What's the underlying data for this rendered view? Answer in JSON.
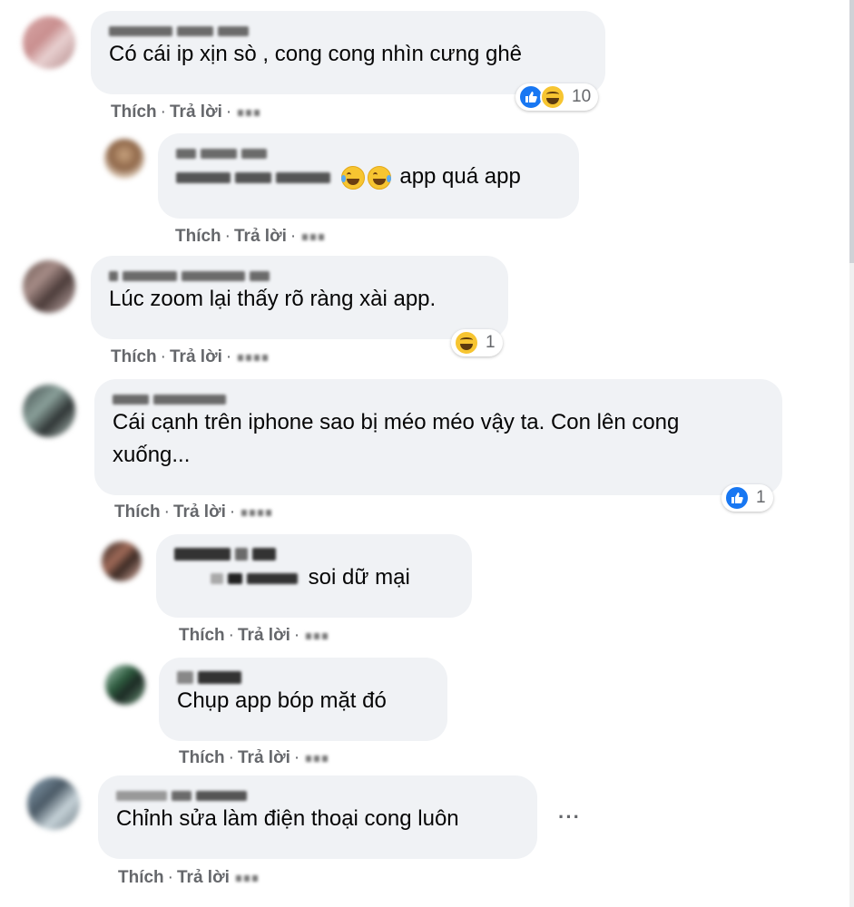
{
  "actions": {
    "like": "Thích",
    "reply": "Trả lời",
    "separator": "·"
  },
  "comments": [
    {
      "text": "Có cái ip xịn sò , cong cong nhìn cưng ghê",
      "reactions": [
        "like-icon",
        "haha-icon"
      ],
      "reaction_count": "10"
    },
    {
      "text": "app quá app",
      "inline_emojis": [
        "haha-icon",
        "haha-icon"
      ]
    },
    {
      "text": "Lúc zoom lại thấy rõ ràng xài app.",
      "reactions": [
        "haha-icon"
      ],
      "reaction_count": "1"
    },
    {
      "text": "Cái cạnh trên iphone sao bị méo méo vậy ta. Con lên cong xuống...",
      "reactions": [
        "like-icon"
      ],
      "reaction_count": "1"
    },
    {
      "text": "soi dữ mại"
    },
    {
      "text": "Chụp app bóp mặt đó"
    },
    {
      "text": "Chỉnh sửa làm điện thoại cong luôn"
    }
  ],
  "more_menu": "···"
}
